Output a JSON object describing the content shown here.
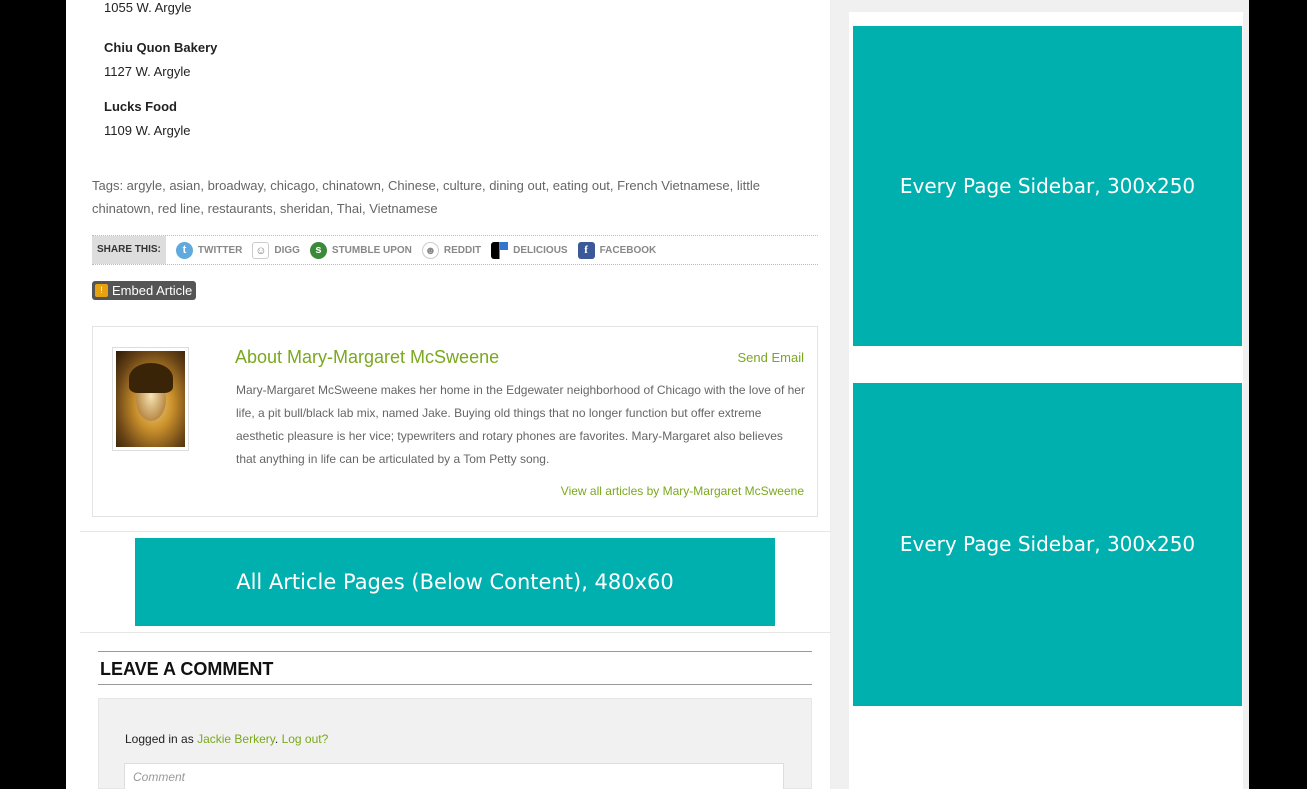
{
  "venues": [
    {
      "address": "1055 W. Argyle"
    },
    {
      "name": "Chiu Quon Bakery",
      "address": "1127 W. Argyle"
    },
    {
      "name": "Lucks Food",
      "address": "1109 W. Argyle"
    }
  ],
  "tags_text": "Tags: argyle, asian, broadway, chicago, chinatown, Chinese, culture, dining out, eating out, French Vietnamese, little chinatown, red line, restaurants, sheridan, Thai, Vietnamese",
  "share": {
    "label": "SHARE THIS:",
    "items": [
      {
        "label": "TWITTER",
        "icon": "twitter-icon"
      },
      {
        "label": "DIGG",
        "icon": "digg-icon"
      },
      {
        "label": "STUMBLE UPON",
        "icon": "stumbleupon-icon"
      },
      {
        "label": "REDDIT",
        "icon": "reddit-icon"
      },
      {
        "label": "DELICIOUS",
        "icon": "delicious-icon"
      },
      {
        "label": "FACEBOOK",
        "icon": "facebook-icon"
      }
    ]
  },
  "embed_label": "Embed Article",
  "author": {
    "title": "About Mary-Margaret McSweene",
    "send_email": "Send Email",
    "bio": "Mary-Margaret McSweene makes her home in the Edgewater neighborhood of Chicago with the love of her life, a pit bull/black lab mix, named Jake. Buying old things that no longer function but offer extreme aesthetic pleasure is her vice; typewriters and rotary phones are favorites. Mary-Margaret also believes that anything in life can be articulated by a Tom Petty song.",
    "view_all": "View all articles by Mary-Margaret McSweene"
  },
  "ads": {
    "below_content": "All Article Pages (Below Content), 480x60",
    "sidebar_1": "Every Page Sidebar, 300x250",
    "sidebar_2": "Every Page Sidebar, 300x250"
  },
  "comments": {
    "heading": "LEAVE A COMMENT",
    "logged_in_prefix": "Logged in as",
    "user": "Jackie Berkery",
    "logout": "Log out?",
    "placeholder": "Comment"
  },
  "colors": {
    "accent_green": "#7aa81e",
    "ad_teal": "#00b0ae"
  }
}
